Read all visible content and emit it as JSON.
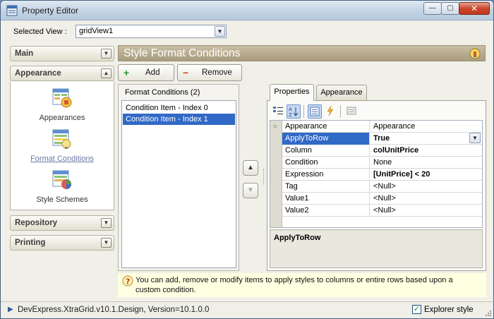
{
  "window": {
    "title": "Property Editor",
    "controls": {
      "minimize": "—",
      "maximize": "▢",
      "close": "✕"
    }
  },
  "selected_view": {
    "label": "Selected View :",
    "value": "gridView1"
  },
  "nav": {
    "groups": [
      {
        "label": "Main",
        "expanded": false
      },
      {
        "label": "Appearance",
        "expanded": true
      },
      {
        "label": "Repository",
        "expanded": false
      },
      {
        "label": "Printing",
        "expanded": false
      }
    ],
    "items": [
      {
        "label": "Appearances",
        "icon": "appearances-icon"
      },
      {
        "label": "Format Conditions",
        "icon": "format-conditions-icon",
        "selected": true
      },
      {
        "label": "Style Schemes",
        "icon": "style-schemes-icon"
      }
    ]
  },
  "header": {
    "title": "Style Format Conditions",
    "icon": "bulb-icon"
  },
  "toolbar": {
    "add_label": "Add",
    "remove_label": "Remove"
  },
  "format_conditions": {
    "title": "Format Conditions (2)",
    "items": [
      "Condition Item - Index 0",
      "Condition Item - Index 1"
    ],
    "selected_index": 1
  },
  "tabs": [
    {
      "label": "Properties",
      "active": true
    },
    {
      "label": "Appearance",
      "active": false
    }
  ],
  "property_grid": {
    "rows": [
      {
        "name": "Appearance",
        "value": "Appearance",
        "bold": false,
        "expandable": true
      },
      {
        "name": "ApplyToRow",
        "value": "True",
        "bold": true,
        "selected": true
      },
      {
        "name": "Column",
        "value": "colUnitPrice",
        "bold": true
      },
      {
        "name": "Condition",
        "value": "None",
        "bold": false
      },
      {
        "name": "Expression",
        "value": "[UnitPrice] < 20",
        "bold": true
      },
      {
        "name": "Tag",
        "value": "<Null>",
        "bold": false
      },
      {
        "name": "Value1",
        "value": "<Null>",
        "bold": false
      },
      {
        "name": "Value2",
        "value": "<Null>",
        "bold": false
      }
    ],
    "description": "ApplyToRow"
  },
  "hint": {
    "text": "You can add, remove or modify items to apply styles to columns or entire rows based upon a custom condition."
  },
  "status": {
    "text": "DevExpress.XtraGrid.v10.1.Design, Version=10.1.0.0",
    "explorer_style_label": "Explorer style",
    "explorer_style_checked": true
  },
  "colors": {
    "selection": "#3169c6",
    "header_bar": "#b5a98d",
    "hint_background": "#ffffe1"
  }
}
